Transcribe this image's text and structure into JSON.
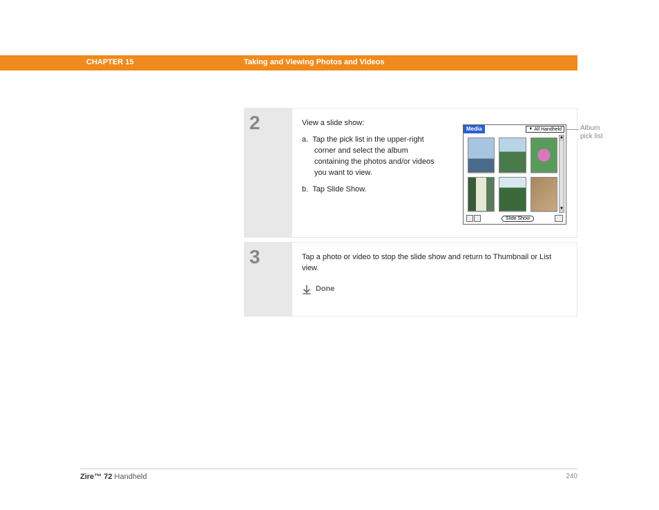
{
  "header": {
    "chapter": "CHAPTER 15",
    "title": "Taking and Viewing Photos and Videos"
  },
  "step2": {
    "number": "2",
    "intro": "View a slide show:",
    "a_prefix": "a.",
    "a_text": "Tap the pick list in the upper-right corner and select the album containing the photos and/or videos you want to view.",
    "b_prefix": "b.",
    "b_text": "Tap Slide Show."
  },
  "step3": {
    "number": "3",
    "text": "Tap a photo or video to stop the slide show and return to Thumbnail or List view.",
    "done": "Done"
  },
  "device": {
    "title": "Media",
    "picklist": "All Handheld",
    "slideshow_btn": "Slide Show"
  },
  "callout": {
    "line1": "Album",
    "line2": "pick list"
  },
  "footer": {
    "brand": "Zire™ 72",
    "product": " Handheld",
    "page": "240"
  }
}
